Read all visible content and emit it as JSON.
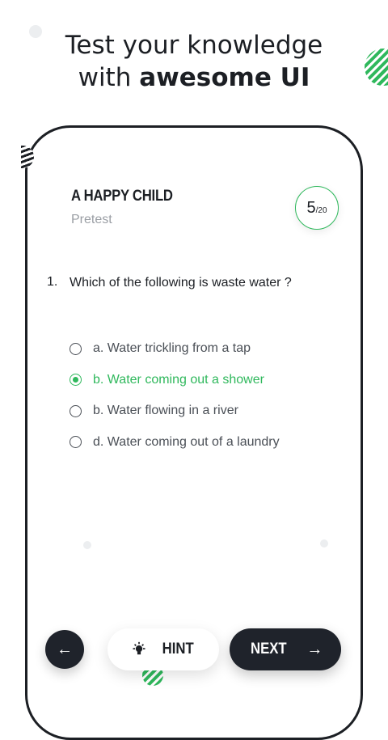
{
  "headline": {
    "line1": "Test your knowledge",
    "line2_prefix": "with ",
    "line2_bold": "awesome UI"
  },
  "quiz": {
    "title": "A HAPPY CHILD",
    "subtitle": "Pretest",
    "progress_current": "5",
    "progress_total": "/20"
  },
  "question": {
    "number": "1.",
    "text": "Which of the following is waste water ?",
    "options": [
      {
        "label": "a.  Water trickling from a tap",
        "selected": false
      },
      {
        "label": "b.  Water coming out a shower",
        "selected": true
      },
      {
        "label": "b.  Water flowing in a river",
        "selected": false
      },
      {
        "label": "d.  Water coming out of a laundry",
        "selected": false
      }
    ]
  },
  "buttons": {
    "hint": "HINT",
    "next": "NEXT"
  },
  "colors": {
    "accent": "#2fb85c",
    "dark": "#1f232b"
  },
  "icons": {
    "back": "arrow-left-icon",
    "hint": "lightbulb-icon",
    "next": "arrow-right-icon"
  }
}
